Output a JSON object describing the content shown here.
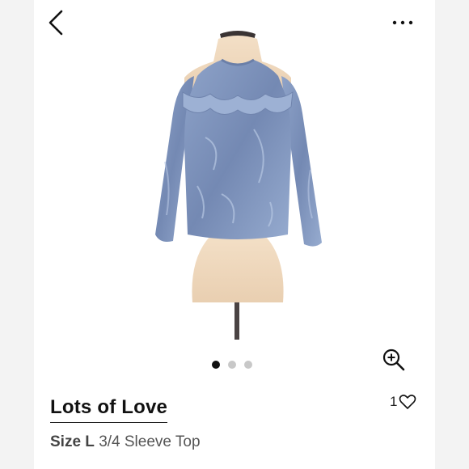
{
  "icons": {
    "back": "chevron-left-icon",
    "more": "more-horizontal-icon",
    "zoom": "zoom-in-icon",
    "like": "heart-icon"
  },
  "carousel": {
    "total": 3,
    "active": 1
  },
  "likes": {
    "count": "1"
  },
  "product": {
    "brand": "Lots of Love",
    "size_label": "Size L",
    "description": "3/4 Sleeve Top"
  },
  "colors": {
    "top": "#7f95bd",
    "mannequin": "#efd9bf"
  }
}
